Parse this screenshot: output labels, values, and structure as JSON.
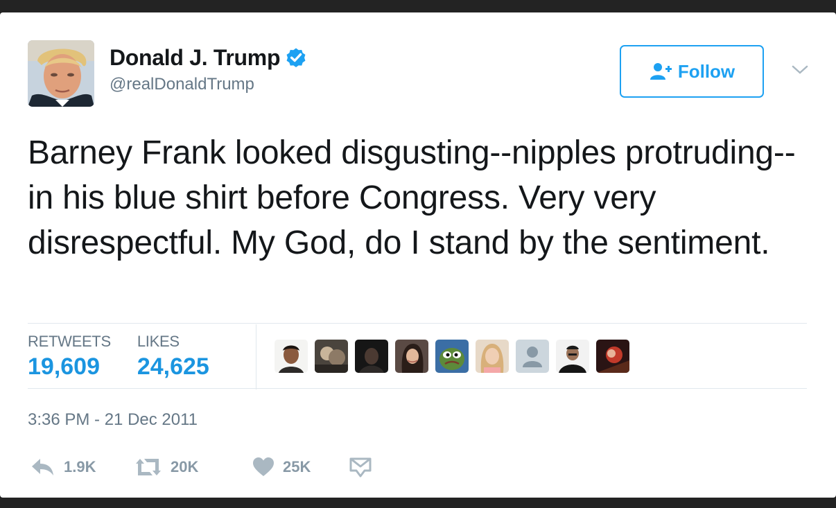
{
  "profile": {
    "display_name": "Donald J. Trump",
    "handle": "@realDonaldTrump",
    "verified": true,
    "verified_icon": "verified-badge-icon",
    "avatar_icon": "profile-photo"
  },
  "follow_button": {
    "label": "Follow",
    "icon": "add-user-icon"
  },
  "menu_icon": "chevron-down-icon",
  "tweet": {
    "text": "Barney Frank looked disgusting--nipples protruding--in his blue shirt before Congress. Very very disrespectful. My God, do I stand by the sentiment.",
    "timestamp": "3:36 PM - 21 Dec 2011"
  },
  "stats": {
    "retweets_label": "RETWEETS",
    "retweets_value": "19,609",
    "likes_label": "LIKES",
    "likes_value": "24,625"
  },
  "likers": [
    {
      "icon": "liker-avatar-1"
    },
    {
      "icon": "liker-avatar-2"
    },
    {
      "icon": "liker-avatar-3"
    },
    {
      "icon": "liker-avatar-4"
    },
    {
      "icon": "liker-avatar-5"
    },
    {
      "icon": "liker-avatar-6"
    },
    {
      "icon": "liker-avatar-default"
    },
    {
      "icon": "liker-avatar-8"
    },
    {
      "icon": "liker-avatar-9"
    }
  ],
  "actions": {
    "reply": {
      "icon": "reply-icon",
      "count": "1.9K"
    },
    "retweet": {
      "icon": "retweet-icon",
      "count": "20K"
    },
    "like": {
      "icon": "heart-icon",
      "count": "25K"
    },
    "message": {
      "icon": "direct-message-icon"
    }
  },
  "colors": {
    "accent": "#1da1f2",
    "link": "#1b95e0",
    "text": "#14171a",
    "muted": "#657786",
    "action_gray": "#8899a6",
    "divider": "#e1e8ed"
  }
}
